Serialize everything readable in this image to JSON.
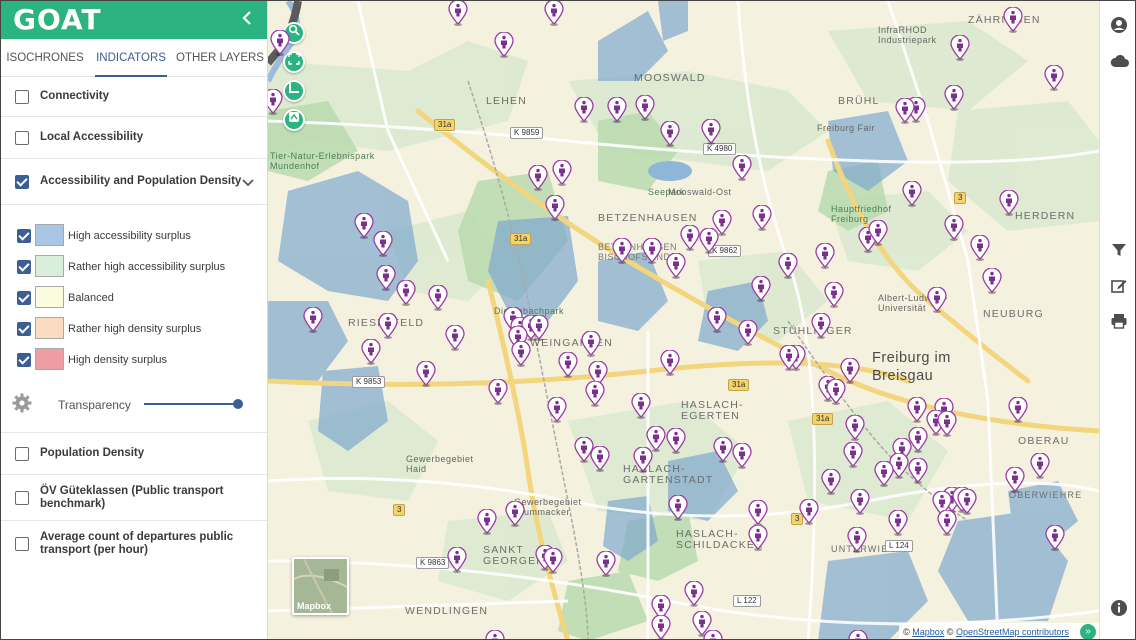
{
  "app": {
    "logo": "GOAT",
    "collapse_icon": "chevron-left-icon",
    "brand_color": "#2bb381",
    "accent_color": "#3b5e95"
  },
  "tabs": [
    {
      "label": "ISOCHRONES",
      "active": false
    },
    {
      "label": "INDICATORS",
      "active": true
    },
    {
      "label": "OTHER LAYERS",
      "active": false
    }
  ],
  "layers": {
    "connectivity": {
      "label": "Connectivity",
      "checked": false
    },
    "local_accessibility": {
      "label": "Local Accessibility",
      "checked": false
    },
    "acc_pop_density": {
      "label": "Accessibility and Population Density",
      "checked": true,
      "expanded": true
    },
    "population_density": {
      "label": "Population Density",
      "checked": false
    },
    "oev": {
      "label": "ÖV Güteklassen (Public transport benchmark)",
      "checked": false
    },
    "departures": {
      "label": "Average count of departures public transport (per hour)",
      "checked": false
    }
  },
  "legend": [
    {
      "label": "High accessibility surplus",
      "color": "#a9c6e4",
      "checked": true
    },
    {
      "label": "Rather high accessibility surplus",
      "color": "#d9eedb",
      "checked": true
    },
    {
      "label": "Balanced",
      "color": "#fbfbe0",
      "checked": true
    },
    {
      "label": "Rather high density surplus",
      "color": "#fbdcc0",
      "checked": true
    },
    {
      "label": "High density surplus",
      "color": "#ee9ea2",
      "checked": true
    }
  ],
  "transparency": {
    "label": "Transparency",
    "value": 1.0
  },
  "map": {
    "labels": {
      "lehen": "LEHEN",
      "mooswald": "MOOSWALD",
      "bruehl": "BRÜHL",
      "zaehringen": "ZÄHRINGEN",
      "betzenhausen": "BETZENHAUSEN",
      "herdern": "HERDERN",
      "neuburg": "NEUBURG",
      "stuehlinger": "STÜHLINGER",
      "weingarten": "WEINGARTEN",
      "haslach_egerten": "HASLACH-\nEGERTEN",
      "haslach_gartenstadt": "HASLACH-\nGARTENSTADT",
      "haslach_schildacker": "HASLACH-\nSCHILDACKER",
      "sankt_georgen": "SANKT\nGEORGEN",
      "oberau": "OBERAU",
      "oberwiehre": "OBERWIEHRE",
      "unterwiehre": "UNTERWIEHRE",
      "wendlingen": "WENDLINGEN",
      "rieselfeld": "RIESELFELD",
      "city": "Freiburg im\nBreisgau",
      "seepark": "Seepark",
      "dietenbachpark": "Dietenbachpark",
      "tiergehege": "Tier-Natur-Erlebnispark\nMundenhof",
      "industriepark": "InfraRHOD\nIndustriepark",
      "freiburg_fair": "Freiburg Fair",
      "hauptfriedhof": "Hauptfriedhof\nFreiburg",
      "albert_ludwigs": "Albert-Ludwigs-\nUniversität",
      "gewerbegebiet_haid": "Gewerbegebiet\nHaid",
      "gewerbegebiet_krummacker": "Gewerbegebiet\nKrummacker",
      "moos_ost": "Mooswald-Ost",
      "besselsdorf": "BETZENHAUSEN\nBISCHOFSLINDE"
    },
    "shields": [
      "K 9859",
      "31a",
      "31a",
      "31a",
      "K 4980",
      "K 9853",
      "K 9863",
      "3",
      "3",
      "3",
      "L 124",
      "L 122",
      "K 9862",
      "31a"
    ],
    "minimap_label": "Mapbox",
    "attribution": {
      "prefix": "©",
      "mapbox": "Mapbox",
      "sep": "©",
      "osm": "OpenStreetMap contributors"
    }
  },
  "rail_icons": [
    "user-account-icon",
    "cloud-icon",
    "filter-icon",
    "edit-icon",
    "print-icon",
    "info-icon"
  ]
}
